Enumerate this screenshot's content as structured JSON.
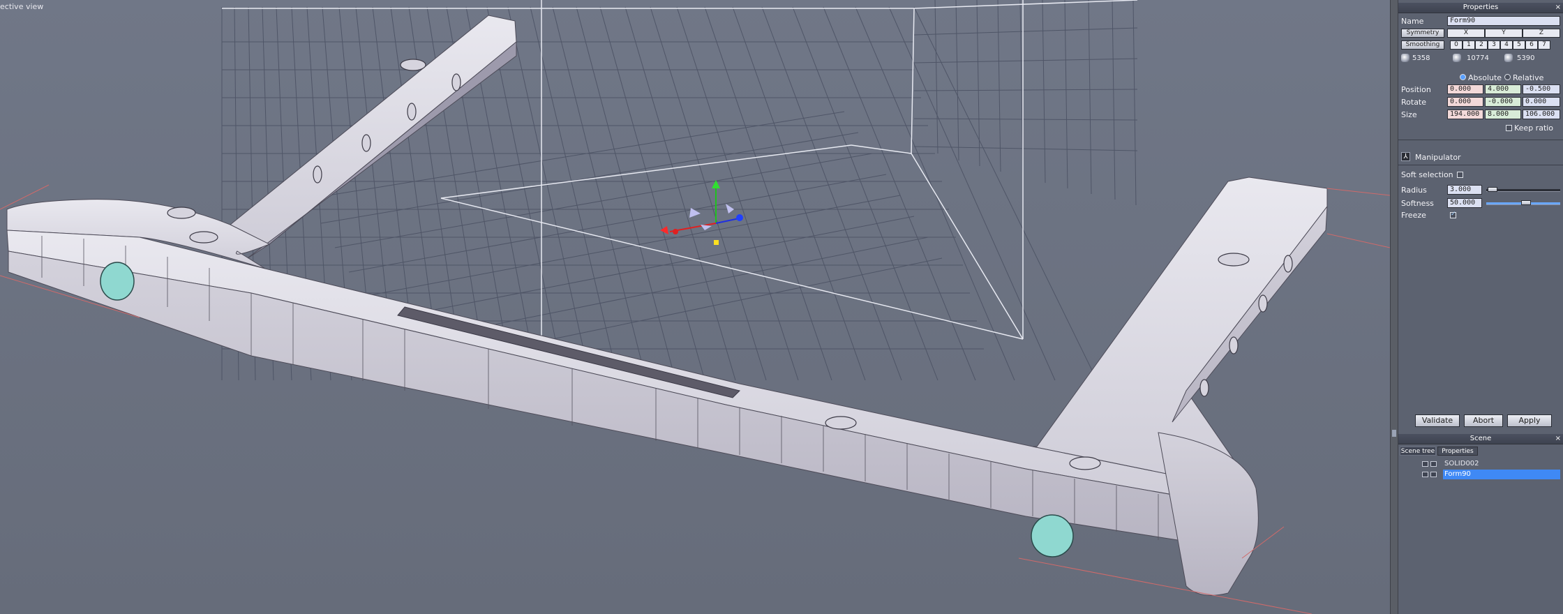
{
  "viewport": {
    "title": "ective view"
  },
  "properties": {
    "header": "Properties",
    "name_label": "Name",
    "name_value": "Form90",
    "symmetry_label": "Symmetry",
    "axes": [
      "X",
      "Y",
      "Z"
    ],
    "smoothing_label": "Smoothing",
    "smoothing_levels": [
      "0",
      "1",
      "2",
      "3",
      "4",
      "5",
      "6",
      "7"
    ],
    "stats": [
      "5358",
      "10774",
      "5390"
    ],
    "absolute_label": "Absolute",
    "relative_label": "Relative",
    "position_label": "Position",
    "position": [
      "0.000",
      "4.000",
      "-0.500"
    ],
    "rotate_label": "Rotate",
    "rotate": [
      "0.000",
      "-0.000",
      "0.000"
    ],
    "size_label": "Size",
    "size": [
      "194.000",
      "8.000",
      "106.000"
    ],
    "keep_ratio_label": "Keep ratio",
    "manipulator_label": "Manipulator",
    "soft_selection_label": "Soft selection",
    "radius_label": "Radius",
    "radius_value": "3.000",
    "softness_label": "Softness",
    "softness_value": "50.000",
    "freeze_label": "Freeze",
    "validate_label": "Validate",
    "abort_label": "Abort",
    "apply_label": "Apply"
  },
  "scene": {
    "header": "Scene",
    "tab_scene_tree": "Scene tree",
    "tab_properties": "Properties",
    "items": [
      {
        "name": "SOLID002",
        "selected": false
      },
      {
        "name": "Form90",
        "selected": true
      }
    ]
  },
  "colors": {
    "viewport_bg": "#6e7584",
    "panel_bg": "#5c6270",
    "selection": "#3f89f5",
    "gizmo_x": "#e02020",
    "gizmo_y": "#20c020",
    "gizmo_z": "#2030e0"
  },
  "gizmo": {
    "icon": "transform-gizmo-icon"
  }
}
